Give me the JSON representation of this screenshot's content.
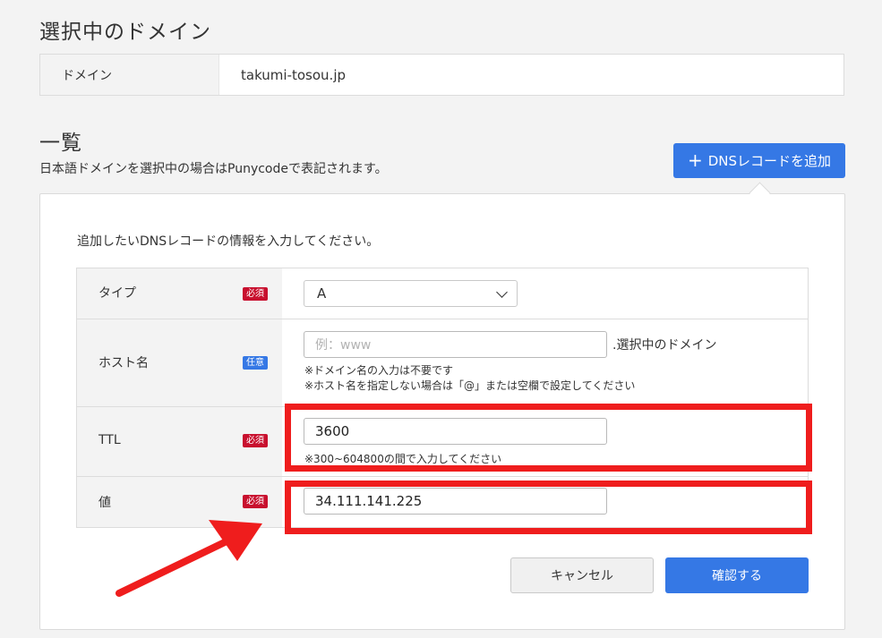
{
  "selected_domain": {
    "title": "選択中のドメイン",
    "label": "ドメイン",
    "value": "takumi-tosou.jp"
  },
  "list": {
    "title": "一覧",
    "note": "日本語ドメインを選択中の場合はPunycodeで表記されます。",
    "add_button_label": "DNSレコードを追加",
    "add_button_icon": "plus-icon"
  },
  "form": {
    "intro": "追加したいDNSレコードの情報を入力してください。",
    "rows": {
      "type": {
        "label": "タイプ",
        "badge": "必須",
        "value": "A"
      },
      "host": {
        "label": "ホスト名",
        "badge": "任意",
        "placeholder": "例：www",
        "suffix": ".選択中のドメイン",
        "help1": "※ドメイン名の入力は不要です",
        "help2": "※ホスト名を指定しない場合は「@」または空欄で設定してください"
      },
      "ttl": {
        "label": "TTL",
        "badge": "必須",
        "value": "3600",
        "help": "※300~604800の間で入力してください"
      },
      "value": {
        "label": "値",
        "badge": "必須",
        "value": "34.111.141.225"
      }
    },
    "cancel_label": "キャンセル",
    "confirm_label": "確認する"
  },
  "colors": {
    "primary": "#3578e5",
    "required_badge": "#c8102e",
    "annotation_red": "#ef1d1d"
  }
}
